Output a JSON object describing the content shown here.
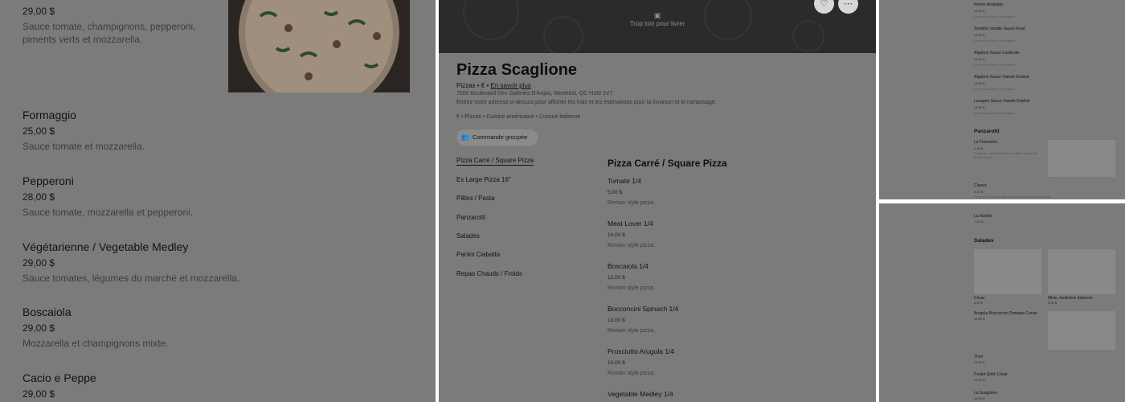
{
  "left_panel": {
    "top_item": {
      "price": "29,00 $",
      "description": "Sauce tomate, champignons, pepperoni, piments verts et mozzarella."
    },
    "items": [
      {
        "name": "Formaggio",
        "price": "25,00 $",
        "description": "Sauce tomate et mozzarella."
      },
      {
        "name": "Pepperoni",
        "price": "28,00 $",
        "description": "Sauce tomate, mozzarella et pepperoni."
      },
      {
        "name": "Végétarienne / Vegetable Medley",
        "price": "29,00 $",
        "description": "Sauce tomates, légumes du marché et mozzarella."
      },
      {
        "name": "Boscaiola",
        "price": "29,00 $",
        "description": "Mozzarella et champignons mixte."
      },
      {
        "name": "Cacio e Peppe",
        "price": "29,00 $",
        "description": ""
      }
    ]
  },
  "center_panel": {
    "hero_status": "Trop loin pour livrer",
    "favorite_icon": "heart-icon",
    "more_icon": "more-horizontal-icon",
    "restaurant_name": "Pizza Scaglione",
    "meta_prefix": "Pizzas • € •",
    "learn_more": "En savoir plus",
    "address": "7500 Boulevard Des Galeries D'Anjou, Montréal, QC H1M 1V7",
    "delivery_note": "Entrez votre adresse ci-dessus pour afficher les frais et les estimations pour la livraison et le ramassage.",
    "tags": "€ • Pizzas • Cuisine américaine • Cuisine italienne",
    "group_order_label": "Commande groupée",
    "nav": [
      "Pizza Carré / Square Pizza",
      "Ex Large Pizza 16\"",
      "Pâtes / Pasta",
      "Panzarotti",
      "Salades",
      "Panini Ciabatta",
      "Repas Chauds / Froids"
    ],
    "section_title": "Pizza Carré / Square Pizza",
    "items": [
      {
        "name": "Tomate 1/4",
        "price": "5,00 $",
        "description": "Roman style pizza."
      },
      {
        "name": "Meat Lover 1/4",
        "price": "14,00 $",
        "description": "Roman style pizza."
      },
      {
        "name": "Boscaiola 1/4",
        "price": "12,00 $",
        "description": "Roman style pizza."
      },
      {
        "name": "Bocconcini Spinach 1/4",
        "price": "13,00 $",
        "description": "Roman style pizza."
      },
      {
        "name": "Prosciutto Arugula 1/4",
        "price": "14,00 $",
        "description": "Roman style pizza."
      },
      {
        "name": "Vegetable Medley 1/4",
        "price": "",
        "description": ""
      }
    ]
  },
  "right_top": {
    "pasta": [
      {
        "name": "Penne Arrabiata",
        "price": "12,00 $",
        "description": "Servi avec pain à l'ail maison"
      },
      {
        "name": "Tortellini Viande Sauce Rosé",
        "price": "14,00 $",
        "description": "Servi avec pain à l'ail maison"
      },
      {
        "name": "Rigatoni Sauce Cardinale",
        "price": "12,00 $",
        "description": "Servi avec pain à l'ail maison"
      },
      {
        "name": "Rigatoni Sauce Viande Gratiné",
        "price": "14,50 $",
        "description": "Servi avec pain à l'ail maison"
      },
      {
        "name": "Lasagne Sauce Viande Gratiné",
        "price": "14,50 $",
        "description": "Servi avec pain à l'ail maison"
      }
    ],
    "panzarotti_title": "Panzarotti",
    "panzarotti": [
      {
        "name": "La Florentine",
        "price": "9,00 $",
        "description": "Épinards, sauce tomates, ricotta, mozzarella et parmesan."
      },
      {
        "name": "Classic",
        "price": "9,00 $",
        "description": "Pepperoni, mozzarella, champignons et sauce tomate."
      }
    ]
  },
  "right_bottom": {
    "top_item": {
      "name": "La Nutella",
      "price": "7,00 $"
    },
    "salads_title": "Salades",
    "salads": [
      {
        "name": "César",
        "price": "6,50 $"
      },
      {
        "name": "Mixte Jardinière Italienne",
        "price": "8,50 $"
      },
      {
        "name": "Arugula Bocconcini Tomates Cerise",
        "price": "12,00 $"
      },
      {
        "name": "Thon",
        "price": "13,00 $"
      },
      {
        "name": "Poulet Grillé César",
        "price": "12,00 $"
      },
      {
        "name": "La Scaglione",
        "price": "14,00 $"
      }
    ]
  },
  "colors": {
    "overlay": "#7b7b7b",
    "hero": "#2b2b2b",
    "text": "#121212"
  }
}
